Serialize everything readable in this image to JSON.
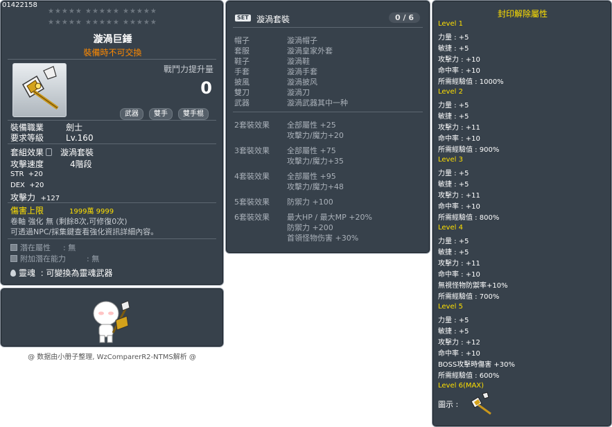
{
  "item": {
    "id": "01422158",
    "stars": [
      "★★★★★   ★★★★★   ★★★★★",
      "★★★★★   ★★★★★   ★★★★★"
    ],
    "name": "漩渦巨錘",
    "trade_note": "裝備時不可交換",
    "power_label": "戰鬥力提升量",
    "power_value": "0",
    "tags": [
      "武器",
      "雙手",
      "雙手棍"
    ],
    "req_job_label": "裝備職業",
    "req_job": "劍士",
    "req_level_label": "要求等級",
    "req_level": "Lv.160",
    "set_label": "套組效果",
    "set_value": "漩渦套裝",
    "speed_label": "攻擊速度",
    "speed_value": "4階段",
    "stats": [
      {
        "k": "STR",
        "v": "+20"
      },
      {
        "k": "DEX",
        "v": "+20"
      },
      {
        "k": "攻擊力",
        "v": "+127"
      }
    ],
    "damage_cap_label": "傷害上限",
    "damage_cap_value": "1999萬 9999",
    "scroll_line": "卷軸 強化 無 (剩餘8次,可修復0次)",
    "npc_line": "可透過NPC/採集鍵查看強化資訊詳細內容。",
    "potential_label": "潛在屬性",
    "potential_value": ": 無",
    "bonus_potential_label": "附加潛在能力",
    "bonus_potential_value": ": 無",
    "soul_label": "靈魂",
    "soul_value": ": 可變換為靈魂武器"
  },
  "credit": "@ 数据由小册子整理, WzComparerR2-NTMS解析 @",
  "set": {
    "badge": "SET",
    "name": "漩渦套裝",
    "count": "0 / 6",
    "parts": [
      {
        "slot": "帽子",
        "name": "漩渦帽子"
      },
      {
        "slot": "套服",
        "name": "漩渦皇家外套"
      },
      {
        "slot": "鞋子",
        "name": "漩渦鞋"
      },
      {
        "slot": "手套",
        "name": "漩渦手套"
      },
      {
        "slot": "披風",
        "name": "漩渦披风"
      },
      {
        "slot": "雙刀",
        "name": "漩渦刀"
      },
      {
        "slot": "武器",
        "name": "漩渦武器其中一种"
      }
    ],
    "effects": [
      {
        "label": "2套裝效果",
        "lines": [
          "全部屬性  +25",
          "攻擊力/魔力+20"
        ]
      },
      {
        "label": "3套裝效果",
        "lines": [
          "全部屬性  +75",
          "攻擊力/魔力+35"
        ]
      },
      {
        "label": "4套裝效果",
        "lines": [
          "全部屬性  +95",
          "攻擊力/魔力+48"
        ]
      },
      {
        "label": "5套裝效果",
        "lines": [
          "防禦力  +100"
        ]
      },
      {
        "label": "6套裝效果",
        "lines": [
          "最大HP / 最大MP  +20%",
          "防禦力  +200",
          "首領怪物伤害 +30%"
        ]
      }
    ]
  },
  "seal": {
    "title": "封印解除屬性",
    "levels": [
      {
        "name": "Level 1",
        "lines": [
          "力量 : +5",
          "敏捷 : +5",
          "攻擊力 : +10",
          "命中率 : +10",
          "所需經驗值 : 1000%"
        ]
      },
      {
        "name": "Level 2",
        "lines": [
          "力量 : +5",
          "敏捷 : +5",
          "攻擊力 : +11",
          "命中率 : +10",
          "所需經驗值 : 900%"
        ]
      },
      {
        "name": "Level 3",
        "lines": [
          "力量 : +5",
          "敏捷 : +5",
          "攻擊力 : +11",
          "命中率 : +10",
          "所需經驗值 : 800%"
        ]
      },
      {
        "name": "Level 4",
        "lines": [
          "力量 : +5",
          "敏捷 : +5",
          "攻擊力 : +11",
          "命中率 : +10",
          "無視怪物防禦率+10%",
          "所需經驗值 : 700%"
        ]
      },
      {
        "name": "Level 5",
        "lines": [
          "力量 : +5",
          "敏捷 : +5",
          "攻擊力 : +12",
          "命中率 : +10",
          "BOSS攻擊時傷害 +30%",
          "所需經驗值 : 600%"
        ]
      },
      {
        "name": "Level 6(MAX)",
        "lines": []
      }
    ],
    "icon_label": "圖示 :"
  },
  "colors": {
    "panel": "#37414b",
    "border": "#8f98a3",
    "yellow": "#ffe000",
    "orange": "#ff8a00"
  }
}
